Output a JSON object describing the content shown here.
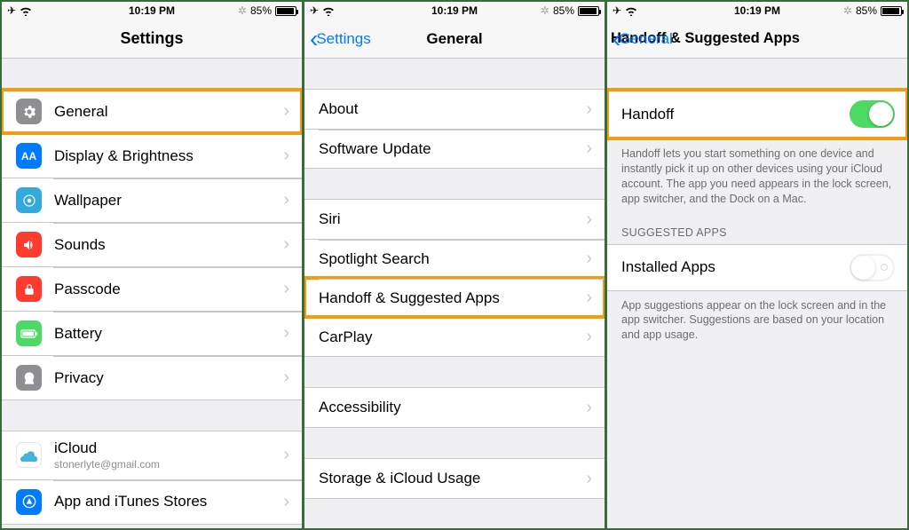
{
  "status": {
    "time": "10:19 PM",
    "battery_pct": "85%"
  },
  "screen1": {
    "title": "Settings",
    "group1": [
      {
        "icon": "gear-icon",
        "bg": "bg-gray",
        "label": "General",
        "highlight": true
      },
      {
        "icon": "display-icon",
        "bg": "bg-blue",
        "label": "Display & Brightness"
      },
      {
        "icon": "wallpaper-icon",
        "bg": "bg-lblue",
        "label": "Wallpaper"
      },
      {
        "icon": "sounds-icon",
        "bg": "bg-red",
        "label": "Sounds"
      },
      {
        "icon": "passcode-icon",
        "bg": "bg-red",
        "label": "Passcode"
      },
      {
        "icon": "battery-icon",
        "bg": "bg-green",
        "label": "Battery"
      },
      {
        "icon": "privacy-icon",
        "bg": "bg-gray",
        "label": "Privacy"
      }
    ],
    "group2": [
      {
        "icon": "icloud-icon",
        "bg": "bg-cloud",
        "label": "iCloud",
        "sub": "stonerlyte@gmail.com"
      },
      {
        "icon": "appstore-icon",
        "bg": "bg-blue",
        "label": "App and iTunes Stores"
      }
    ]
  },
  "screen2": {
    "back": "Settings",
    "title": "General",
    "group1": [
      {
        "label": "About"
      },
      {
        "label": "Software Update"
      }
    ],
    "group2": [
      {
        "label": "Siri"
      },
      {
        "label": "Spotlight Search"
      },
      {
        "label": "Handoff & Suggested Apps",
        "highlight": true
      },
      {
        "label": "CarPlay"
      }
    ],
    "group3": [
      {
        "label": "Accessibility"
      }
    ],
    "group4": [
      {
        "label": "Storage & iCloud Usage"
      }
    ]
  },
  "screen3": {
    "back": "General",
    "title": "Handoff & Suggested Apps",
    "handoff_label": "Handoff",
    "handoff_footer": "Handoff lets you start something on one device and instantly pick it up on other devices using your iCloud account. The app you need appears in the lock screen, app switcher, and the Dock on a Mac.",
    "suggested_header": "SUGGESTED APPS",
    "installed_label": "Installed Apps",
    "installed_footer": "App suggestions appear on the lock screen and in the app switcher. Suggestions are based on your location and app usage."
  }
}
